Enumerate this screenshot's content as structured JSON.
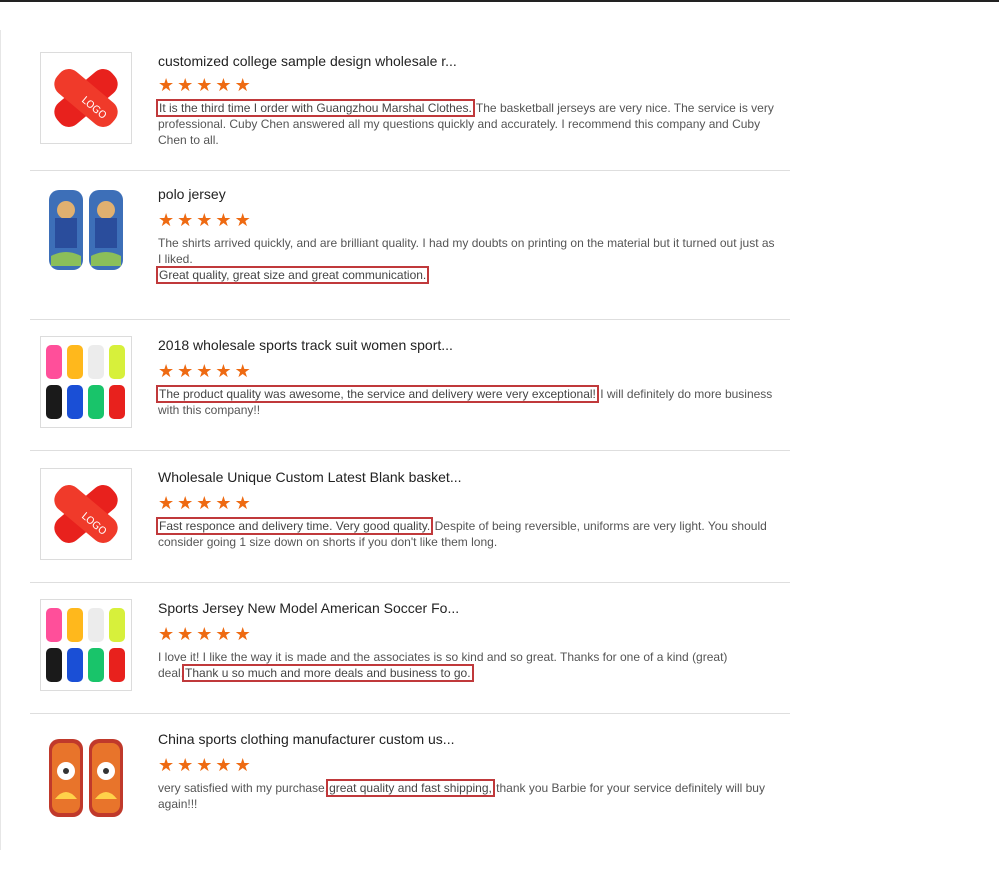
{
  "reviews": [
    {
      "title": "customized college sample design wholesale r...",
      "rating": 5,
      "image": "shin-guard-red-logo",
      "logo_text": "LOGO",
      "highlight": "It is the third time I order with Guangzhou Marshal Clothes.",
      "before": "",
      "after": " The basketball jerseys are very nice. The service is very professional. Cuby Chen answered all my questions quickly and accurately. I recommend this company and Cuby Chen to all."
    },
    {
      "title": "polo jersey",
      "rating": 5,
      "image": "shin-guard-blue-print",
      "before": "The shirts arrived quickly, and are brilliant quality. I had my doubts on printing on the material but it turned out just as I liked.",
      "highlight": "Great quality, great size and great communication.",
      "after": ""
    },
    {
      "title": "2018 wholesale sports track suit women sport...",
      "rating": 5,
      "image": "shin-guard-color-set",
      "before": "",
      "highlight": "The product quality was awesome, the service and delivery were very exceptional!",
      "after": " I will definitely do more business with this company!!"
    },
    {
      "title": "Wholesale Unique Custom Latest Blank basket...",
      "rating": 5,
      "image": "shin-guard-red-logo",
      "logo_text": "LOGO",
      "before": "",
      "highlight": "Fast responce and delivery time. Very good quality.",
      "after": " Despite of being reversible, uniforms are very light. You should consider going 1 size down on shorts if you don't like them long."
    },
    {
      "title": "Sports Jersey New Model American Soccer Fo...",
      "rating": 5,
      "image": "shin-guard-color-set",
      "before": "I love it! I like the way it is made and the associates is so kind and so great. Thanks for one of a kind (great) deal.",
      "highlight": "Thank u so much and more deals and business to go.",
      "after": ""
    },
    {
      "title": "China sports clothing manufacturer custom us...",
      "rating": 5,
      "image": "shin-guard-fire-ball",
      "before": "very satisfied with my purchase,",
      "highlight": "great quality and fast shipping,",
      "after": " thank you Barbie for your service definitely will buy again!!!"
    }
  ],
  "colors": {
    "star": "#ee6a12",
    "highlight_border": "#c0393b",
    "text": "#555555",
    "title": "#222222"
  }
}
